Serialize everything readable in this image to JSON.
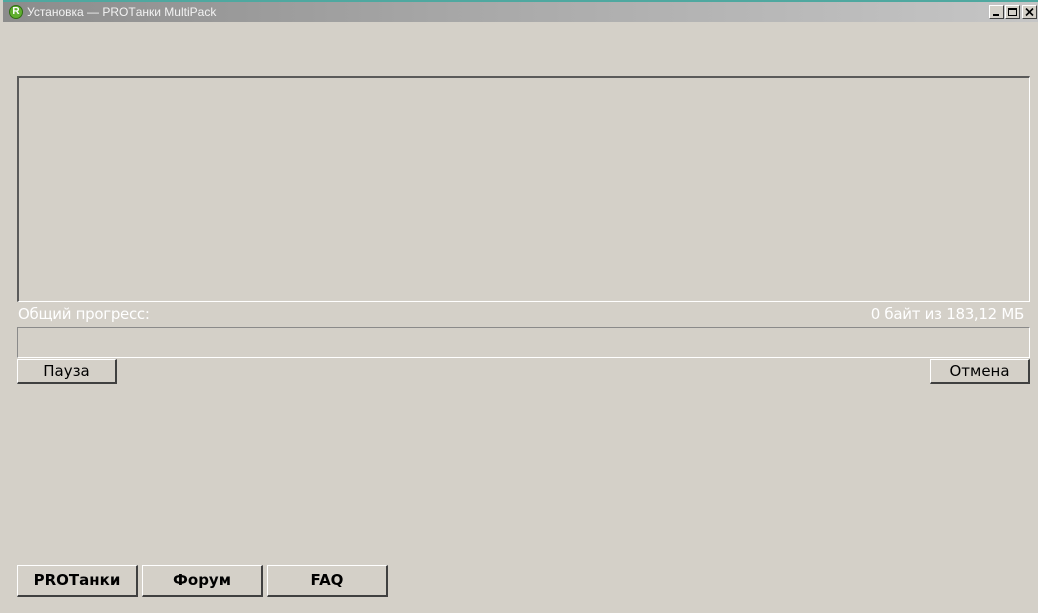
{
  "window": {
    "title": "Установка — PROTанки MultiPack",
    "icon": "protanki-logo-icon",
    "accent_color": "#5fae2e",
    "controls": [
      "minimize-icon",
      "maximize-icon",
      "close-icon"
    ]
  },
  "progress": {
    "label": "Общий прогресс:",
    "value_text": "0 байт из 183,12 МБ",
    "fraction": 0
  },
  "buttons": {
    "pause": "Пауза",
    "cancel": "Отмена"
  },
  "links": {
    "protanki": "PROTанки",
    "forum": "Форум",
    "faq": "FAQ"
  }
}
